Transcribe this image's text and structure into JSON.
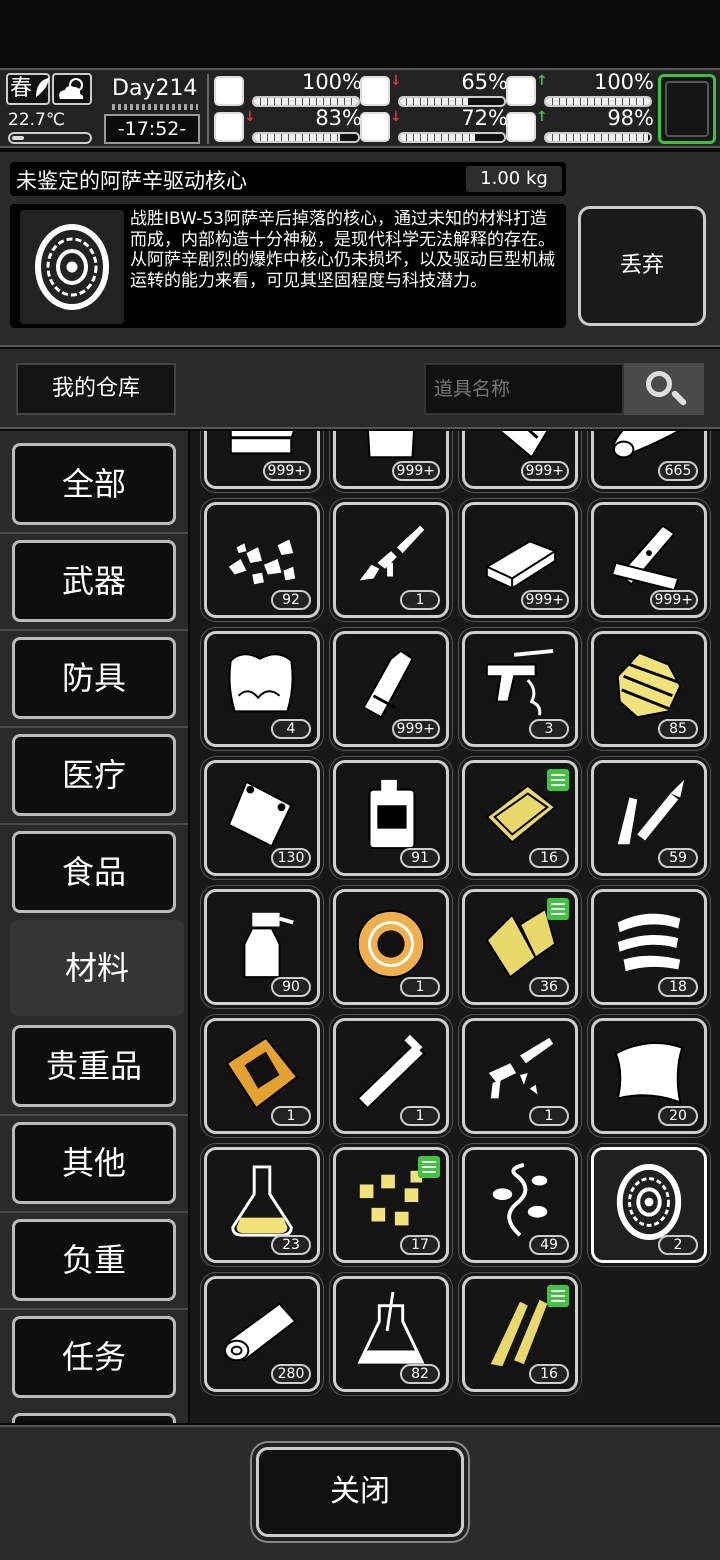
{
  "status": {
    "season": "春",
    "temperature": "22.7℃",
    "day": "Day214",
    "time": "-17:52-",
    "stats": [
      {
        "name": "health",
        "value": "100%",
        "level": 1.0,
        "trend": "",
        "icon": "medkit-icon"
      },
      {
        "name": "hunger",
        "value": "65%",
        "level": 0.65,
        "trend": "down",
        "icon": "stomach-icon"
      },
      {
        "name": "sanity",
        "value": "100%",
        "level": 1.0,
        "trend": "up",
        "icon": "mind-icon"
      },
      {
        "name": "stamina",
        "value": "83%",
        "level": 0.83,
        "trend": "down",
        "icon": "boot-icon"
      },
      {
        "name": "thirst",
        "value": "72%",
        "level": 0.72,
        "trend": "down",
        "icon": "water-drop-icon"
      },
      {
        "name": "mood",
        "value": "98%",
        "level": 0.98,
        "trend": "up",
        "icon": "heart-icon"
      }
    ]
  },
  "detail": {
    "name": "未鉴定的阿萨辛驱动核心",
    "weight": "1.00 kg",
    "description": "战胜IBW-53阿萨辛后掉落的核心，通过未知的材料打造而成，内部构造十分神秘，是现代科学无法解释的存在。从阿萨辛剧烈的爆炸中核心仍未损坏，以及驱动巨型机械运转的能力来看，可见其坚固程度与科技潜力。",
    "discard_label": "丢弃"
  },
  "warehouse": {
    "title": "我的仓库",
    "search_placeholder": "道具名称"
  },
  "categories": [
    {
      "label": "全部",
      "active": false
    },
    {
      "label": "武器",
      "active": false
    },
    {
      "label": "防具",
      "active": false
    },
    {
      "label": "医疗",
      "active": false
    },
    {
      "label": "食品",
      "active": false
    },
    {
      "label": "材料",
      "active": true
    },
    {
      "label": "贵重品",
      "active": false
    },
    {
      "label": "其他",
      "active": false
    },
    {
      "label": "负重",
      "active": false
    },
    {
      "label": "任务",
      "active": false
    }
  ],
  "items": [
    {
      "icon": "folded-cloth-icon",
      "count": "999+"
    },
    {
      "icon": "cloth-bag-icon",
      "count": "999+"
    },
    {
      "icon": "fabric-sheets-icon",
      "count": "999+"
    },
    {
      "icon": "cloth-roll-icon",
      "count": "665"
    },
    {
      "icon": "rubble-icon",
      "count": "92"
    },
    {
      "icon": "broken-rifle-icon",
      "count": "1"
    },
    {
      "icon": "ingot-icon",
      "count": "999+"
    },
    {
      "icon": "wood-planks-icon",
      "count": "999+"
    },
    {
      "icon": "cotton-icon",
      "count": "4"
    },
    {
      "icon": "bottle-icon",
      "count": "999+"
    },
    {
      "icon": "pistol-parts-icon",
      "count": "3"
    },
    {
      "icon": "spring-core-icon",
      "count": "85",
      "color": "#f2e27a"
    },
    {
      "icon": "pouch-icon",
      "count": "130"
    },
    {
      "icon": "jerrycan-icon",
      "count": "91"
    },
    {
      "icon": "gold-plate-icon",
      "count": "16",
      "badge": true,
      "color": "#e8d96a"
    },
    {
      "icon": "soldering-iron-icon",
      "count": "59"
    },
    {
      "icon": "spray-bottle-icon",
      "count": "90"
    },
    {
      "icon": "tape-roll-icon",
      "count": "1",
      "color": "#f0b04c"
    },
    {
      "icon": "gold-wood-icon",
      "count": "36",
      "badge": true,
      "color": "#e8d96a"
    },
    {
      "icon": "metal-strips-icon",
      "count": "18"
    },
    {
      "icon": "microchip-icon",
      "count": "1",
      "color": "#e6a230"
    },
    {
      "icon": "pipe-icon",
      "count": "1"
    },
    {
      "icon": "gun-fragments-icon",
      "count": "1"
    },
    {
      "icon": "paper-sheet-icon",
      "count": "20"
    },
    {
      "icon": "flask-icon",
      "count": "23",
      "color": "#f2e27a"
    },
    {
      "icon": "gold-cubes-icon",
      "count": "17",
      "badge": true,
      "color": "#f2e27a"
    },
    {
      "icon": "vine-icon",
      "count": "49"
    },
    {
      "icon": "drive-core-icon",
      "count": "2",
      "selected": true
    },
    {
      "icon": "log-icon",
      "count": "280"
    },
    {
      "icon": "beaker-icon",
      "count": "82"
    },
    {
      "icon": "gold-shards-icon",
      "count": "16",
      "badge": true,
      "color": "#e8d96a"
    }
  ],
  "footer": {
    "close_label": "关闭"
  }
}
